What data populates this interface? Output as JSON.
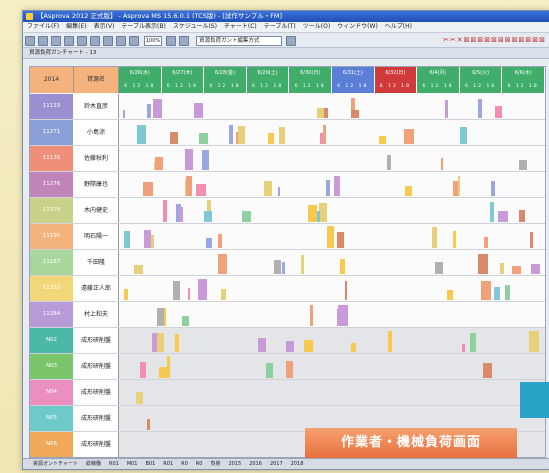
{
  "window": {
    "title": "【Asprova 2012 正式版】 - Asprova MS 15.6.0.1 (TCS版) - [試作サンプル・FM]"
  },
  "menu": [
    "ファイル(F)",
    "編集(E)",
    "表示(V)",
    "テーブル表示(B)",
    "スケジュール(S)",
    "チャート(C)",
    "テーブル(T)",
    "ツール(O)",
    "ウィンドウ(W)",
    "ヘルプ(H)"
  ],
  "toolbar": {
    "zoom": "100%",
    "search": "資源負荷ガント編集方式"
  },
  "chart_title": "資源負荷ガンチャート - 13",
  "header": {
    "id_col": "2014",
    "name_col": "資源名"
  },
  "days": [
    {
      "label": "6/26(水)",
      "color": "#41ad6a"
    },
    {
      "label": "6/27(木)",
      "color": "#41ad6a"
    },
    {
      "label": "6/28(金)",
      "color": "#41ad6a"
    },
    {
      "label": "6/29(土)",
      "color": "#41ad6a"
    },
    {
      "label": "6/30(日)",
      "color": "#41ad6a"
    },
    {
      "label": "6/31(土)",
      "color": "#5b7fd6"
    },
    {
      "label": "6/32(日)",
      "color": "#d13a3a"
    },
    {
      "label": "6/4(月)",
      "color": "#41ad6a"
    },
    {
      "label": "6/5(火)",
      "color": "#41ad6a"
    },
    {
      "label": "6/6(水)",
      "color": "#41ad6a"
    }
  ],
  "day_ticks": "6 12 18",
  "rows": [
    {
      "id": "11133",
      "name": "鈴木直彦",
      "color": "#9c8fd1"
    },
    {
      "id": "11271",
      "name": "小島涼",
      "color": "#8aa0d6"
    },
    {
      "id": "11135",
      "name": "佐藤秋利",
      "color": "#ef8f7a"
    },
    {
      "id": "11276",
      "name": "野際康也",
      "color": "#c084b8"
    },
    {
      "id": "11170",
      "name": "木内健史",
      "color": "#c8d08a"
    },
    {
      "id": "11195",
      "name": "明石陽一",
      "color": "#f4b27c"
    },
    {
      "id": "11187",
      "name": "千田隆",
      "color": "#a9d69a"
    },
    {
      "id": "11232",
      "name": "遠藤正人郎",
      "color": "#f2d77a"
    },
    {
      "id": "11284",
      "name": "村上和夫",
      "color": "#b79ad8"
    },
    {
      "id": "N02",
      "name": "成形研削盤",
      "color": "#4cb8a6"
    },
    {
      "id": "N03",
      "name": "成形研削盤",
      "color": "#7bc66a"
    },
    {
      "id": "N04",
      "name": "成形研削盤",
      "color": "#ea8fbf"
    },
    {
      "id": "N05",
      "name": "成形研削盤",
      "color": "#6ec9c9"
    },
    {
      "id": "N06",
      "name": "成形研削盤",
      "color": "#f0a85a"
    }
  ],
  "banner": "作業者・機械負荷画面",
  "status": [
    "資源ガントチャート",
    "総稼働",
    "R01",
    "M01",
    "B01",
    "R01",
    "R0",
    "R0",
    "負荷",
    "2015",
    "2016",
    "2017",
    "2018"
  ]
}
